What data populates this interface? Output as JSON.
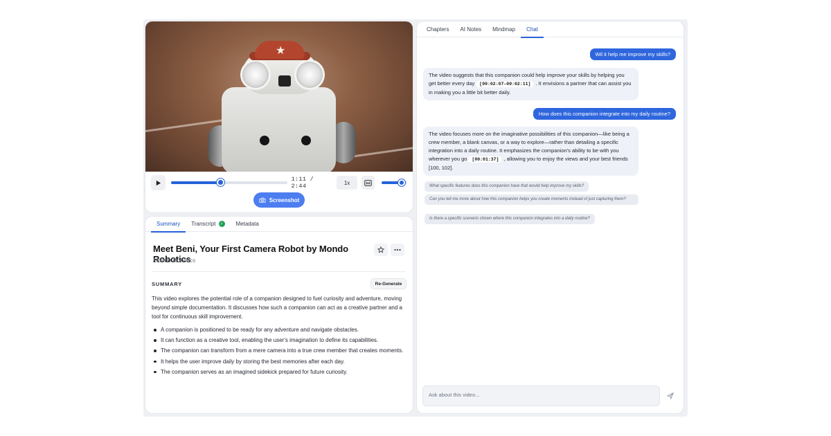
{
  "player": {
    "current_time": "1:11",
    "duration": "2:44",
    "time_display": "1:11 / 2:44",
    "progress_fraction": 0.43,
    "volume_fraction": 0.8,
    "speed": "1x",
    "screenshot_label": "Screenshot"
  },
  "summary_tabs": [
    {
      "label": "Summary",
      "active": true
    },
    {
      "label": "Transcript",
      "active": false
    },
    {
      "label": "Metadata",
      "active": false
    }
  ],
  "video": {
    "title": "Meet Beni, Your First Camera Robot by Mondo Robotics",
    "author": "Mondo Robotics"
  },
  "summary": {
    "heading": "SUMMARY",
    "regenerate_label": "Re-Generate",
    "paragraph": "This video explores the potential role of a companion designed to fuel curiosity and adventure, moving beyond simple documentation. It discusses how such a companion can act as a creative partner and a tool for continuous skill improvement.",
    "bullets": [
      "A companion is positioned to be ready for any adventure and navigate obstacles.",
      "It can function as a creative tool, enabling the user's imagination to define its capabilities.",
      "The companion can transform from a mere camera into a true crew member that creates moments.",
      "It helps the user improve daily by storing the best memories after each day.",
      "The companion serves as an imagined sidekick prepared for future curiosity."
    ]
  },
  "chat_tabs": [
    {
      "label": "Chapters",
      "active": false
    },
    {
      "label": "AI Notes",
      "active": false
    },
    {
      "label": "Mindmap",
      "active": false
    },
    {
      "label": "Chat",
      "active": true
    }
  ],
  "chat": {
    "q1": "Wil it help me improve my skills?",
    "a1": {
      "pre": "The video suggests that this companion could help improve your skills by helping you get better every day",
      "ts": "[00:02:07–00:02:11]",
      "post": ". It envisions a partner that can assist you in making you a little bit better daily."
    },
    "q2": "How does this companion integrate into my daily routine?",
    "a2": {
      "pre": "The video focuses more on the imaginative possibilities of this companion—like being a crew member, a blank canvas, or a way to explore—rather than detailing a specific integration into a daily routine. It emphasizes the companion's ability to be with you wherever you go",
      "ts": "[00:01:37]",
      "post": ", allowing you to enjoy the views and your best friends [100, 102]."
    },
    "suggestions": [
      "What specific features does this companion have that would help improve my skills?",
      "Can you tell me more about how this companion helps you create moments instead of just capturing them?",
      "Is there a specific scenario shown where this companion integrates into a daily routine?"
    ],
    "input_placeholder": "Ask about this video..."
  },
  "colors": {
    "accent": "#2563d8",
    "user_bubble": "#2f66dd",
    "ai_bubble": "#eef1f7",
    "check": "#20a05a"
  },
  "icons": {
    "play": "play-icon",
    "captions": "captions-icon",
    "camera": "camera-icon",
    "star": "star-icon",
    "more": "more-icon",
    "send": "send-icon",
    "check": "check-icon"
  }
}
